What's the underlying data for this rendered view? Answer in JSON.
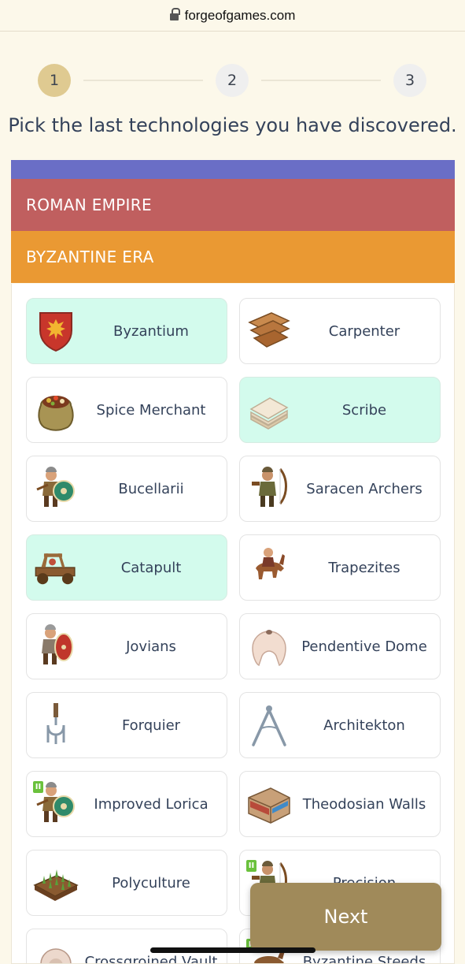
{
  "browser": {
    "url": "forgeofgames.com"
  },
  "stepper": {
    "steps": [
      "1",
      "2",
      "3"
    ],
    "active": 1
  },
  "prompt": "Pick the last technologies you have discovered.",
  "age": "ROMAN EMPIRE",
  "era": "BYZANTINE ERA",
  "colors": {
    "accent_bar": "#6a6ec6",
    "age_band": "#c05f5f",
    "era_band": "#ea9933",
    "selected_card": "#d3fbed",
    "next_button": "#a08a5a"
  },
  "technologies": [
    {
      "label": "Byzantium",
      "icon": "shield-eagle-icon",
      "selected": true
    },
    {
      "label": "Carpenter",
      "icon": "wood-planks-icon",
      "selected": false
    },
    {
      "label": "Spice Merchant",
      "icon": "spice-sack-icon",
      "selected": false
    },
    {
      "label": "Scribe",
      "icon": "paper-stack-icon",
      "selected": true
    },
    {
      "label": "Bucellarii",
      "icon": "soldier-shield-icon",
      "selected": false
    },
    {
      "label": "Saracen Archers",
      "icon": "archer-icon",
      "selected": false
    },
    {
      "label": "Catapult",
      "icon": "catapult-icon",
      "selected": true
    },
    {
      "label": "Trapezites",
      "icon": "horse-rider-icon",
      "selected": false
    },
    {
      "label": "Jovians",
      "icon": "soldier-red-shield-icon",
      "selected": false
    },
    {
      "label": "Pendentive Dome",
      "icon": "dome-icon",
      "selected": false
    },
    {
      "label": "Forquier",
      "icon": "fork-icon",
      "selected": false
    },
    {
      "label": "Architekton",
      "icon": "compass-icon",
      "selected": false
    },
    {
      "label": "Improved Lorica",
      "icon": "soldier-shield-icon",
      "selected": false,
      "level": "II"
    },
    {
      "label": "Theodosian Walls",
      "icon": "walls-icon",
      "selected": false
    },
    {
      "label": "Polyculture",
      "icon": "crop-field-icon",
      "selected": false
    },
    {
      "label": "Precision",
      "icon": "archer-icon",
      "selected": false,
      "level": "II"
    },
    {
      "label": "Crossgroined Vault",
      "icon": "vault-icon",
      "selected": false
    },
    {
      "label": "Byzantine Steeds",
      "icon": "horse-icon",
      "selected": false,
      "level": "II"
    }
  ],
  "next_label": "Next"
}
